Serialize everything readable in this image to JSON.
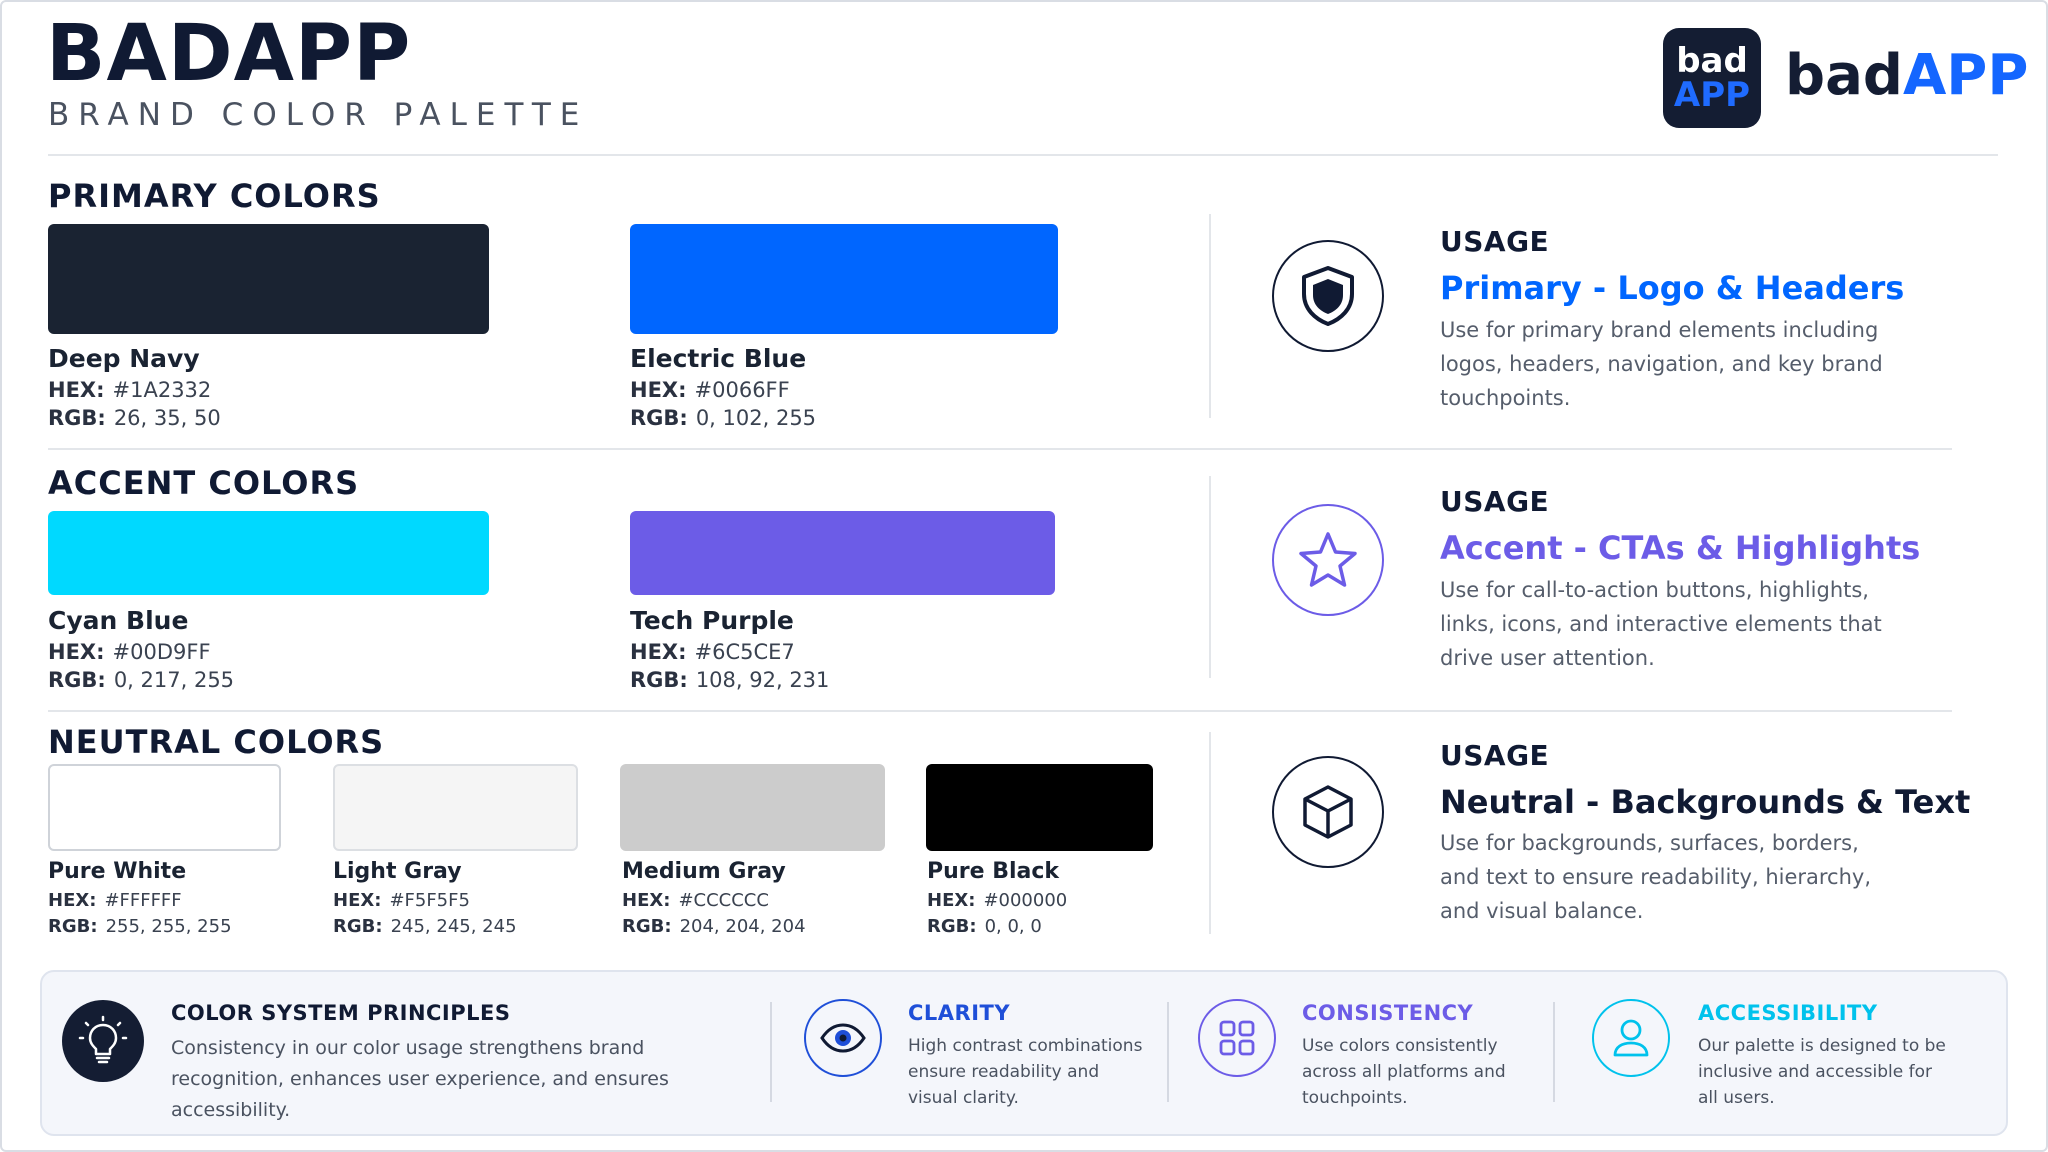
{
  "header": {
    "title": "BADAPP",
    "subtitle": "BRAND COLOR PALETTE",
    "logo_line1": "bad",
    "logo_line2": "APP",
    "wordmark_a": "bad",
    "wordmark_b": "APP"
  },
  "primary": {
    "title": "PRIMARY COLORS",
    "colors": [
      {
        "name": "Deep Navy",
        "hex": "#1A2332",
        "rgb": "26, 35, 50"
      },
      {
        "name": "Electric Blue",
        "hex": "#0066FF",
        "rgb": "0, 102, 255"
      }
    ],
    "usage_label": "USAGE",
    "usage_heading": "Primary - Logo & Headers",
    "usage_desc": "Use for primary brand elements including logos, headers, navigation, and key brand touchpoints.",
    "icon": "shield-icon"
  },
  "accent": {
    "title": "ACCENT COLORS",
    "colors": [
      {
        "name": "Cyan Blue",
        "hex": "#00D9FF",
        "rgb": "0, 217, 255"
      },
      {
        "name": "Tech Purple",
        "hex": "#6C5CE7",
        "rgb": "108, 92, 231"
      }
    ],
    "usage_label": "USAGE",
    "usage_heading": "Accent - CTAs & Highlights",
    "usage_desc": "Use for call-to-action buttons, highlights, links, icons, and interactive elements that drive user attention.",
    "icon": "star-icon"
  },
  "neutral": {
    "title": "NEUTRAL COLORS",
    "colors": [
      {
        "name": "Pure White",
        "hex": "#FFFFFF",
        "rgb": "255, 255, 255"
      },
      {
        "name": "Light Gray",
        "hex": "#F5F5F5",
        "rgb": "245, 245, 245"
      },
      {
        "name": "Medium Gray",
        "hex": "#CCCCCC",
        "rgb": "204, 204, 204"
      },
      {
        "name": "Pure Black",
        "hex": "#000000",
        "rgb": "0, 0, 0"
      }
    ],
    "usage_label": "USAGE",
    "usage_heading": "Neutral - Backgrounds & Text",
    "usage_desc": "Use for backgrounds, surfaces, borders, and text to ensure readability, hierarchy, and visual balance.",
    "icon": "cube-icon"
  },
  "labels": {
    "hex": "HEX:",
    "rgb": "RGB:"
  },
  "footer": {
    "principles_title": "COLOR SYSTEM PRINCIPLES",
    "principles_desc": "Consistency in our color usage strengthens brand recognition, enhances user experience, and ensures accessibility.",
    "items": [
      {
        "title": "CLARITY",
        "desc": "High contrast combinations ensure readability and visual clarity.",
        "color": "#1f4fd8",
        "icon": "eye-icon"
      },
      {
        "title": "CONSISTENCY",
        "desc": "Use colors consistently across all platforms and touchpoints.",
        "color": "#6C5CE7",
        "icon": "grid-icon"
      },
      {
        "title": "ACCESSIBILITY",
        "desc": "Our palette is designed to be inclusive and accessible for all users.",
        "color": "#00c2ec",
        "icon": "user-icon"
      }
    ]
  },
  "colors": {
    "navy": "#1A2332",
    "blue": "#0066FF",
    "cyan": "#00D9FF",
    "purple": "#6C5CE7"
  }
}
